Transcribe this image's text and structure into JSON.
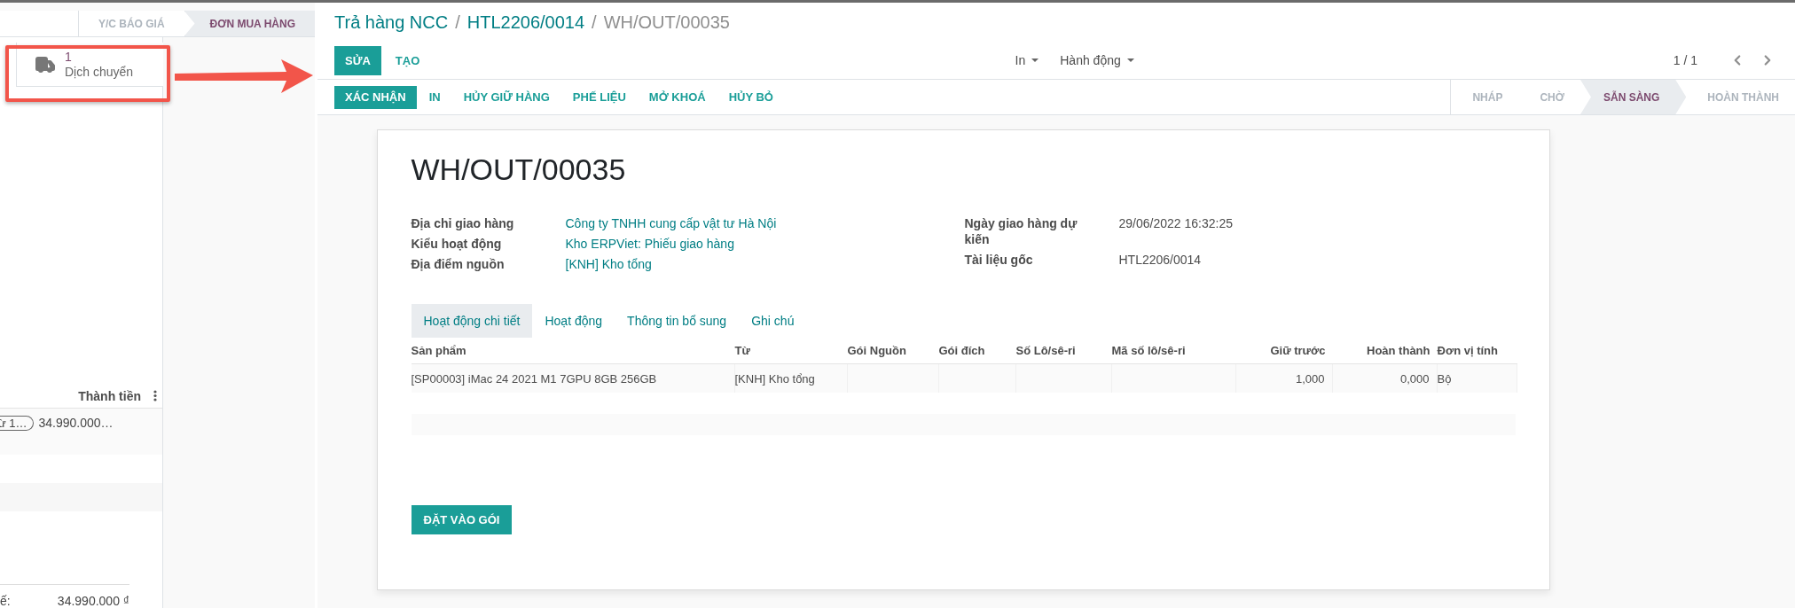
{
  "reference_panel": {
    "stages": [
      {
        "label": "Y/C BÁO GIÁ",
        "selected": false
      },
      {
        "label": "ĐƠN MUA HÀNG",
        "selected": true
      }
    ],
    "smart_button": {
      "count": "1",
      "label": "Dịch chuyển"
    },
    "table": {
      "column": "Thành tiền",
      "rows": [
        {
          "tag": "ừ 1…",
          "amount": "34.990.000…"
        }
      ]
    },
    "totals": [
      {
        "label": "ế:",
        "value": "34.990.000 ₫"
      }
    ]
  },
  "breadcrumb": {
    "separator": "/",
    "items": [
      {
        "label": "Trả hàng NCC",
        "current": false
      },
      {
        "label": "HTL2206/0014",
        "current": false
      },
      {
        "label": "WH/OUT/00035",
        "current": true
      }
    ]
  },
  "buttons": [
    {
      "label": "SỬA",
      "kind": "primary"
    },
    {
      "label": "TẠO",
      "kind": "link"
    }
  ],
  "dropdowns": [
    "In",
    "Hành động"
  ],
  "pager": "1 / 1",
  "actions": [
    {
      "label": "XÁC NHẬN",
      "kind": "primary"
    },
    {
      "label": "IN",
      "kind": "link"
    },
    {
      "label": "HỦY GIỮ HÀNG",
      "kind": "link"
    },
    {
      "label": "PHẾ LIỆU",
      "kind": "link"
    },
    {
      "label": "MỞ KHOÁ",
      "kind": "link"
    },
    {
      "label": "HỦY BỎ",
      "kind": "link"
    }
  ],
  "stages": [
    {
      "label": "NHÁP",
      "selected": false
    },
    {
      "label": "CHỜ",
      "selected": false
    },
    {
      "label": "SẴN SÀNG",
      "selected": true
    },
    {
      "label": "HOÀN THÀNH",
      "selected": false
    }
  ],
  "record": {
    "title": "WH/OUT/00035",
    "fields_left": [
      {
        "label": "Địa chỉ giao hàng",
        "value": "Công ty TNHH cung cấp vật tư Hà Nội"
      },
      {
        "label": "Kiểu hoạt động",
        "value": "Kho ERPViet: Phiếu giao hàng"
      },
      {
        "label": "Địa điểm nguồn",
        "value": "[KNH] Kho tổng"
      }
    ],
    "fields_right": [
      {
        "label": "Ngày giao hàng dự kiến",
        "value": "29/06/2022 16:32:25"
      },
      {
        "label": "Tài liệu gốc",
        "value": "HTL2206/0014"
      }
    ]
  },
  "tabs": [
    {
      "label": "Hoạt động chi tiết",
      "selected": true
    },
    {
      "label": "Hoạt động",
      "selected": false
    },
    {
      "label": "Thông tin bổ sung",
      "selected": false
    },
    {
      "label": "Ghi chú",
      "selected": false
    }
  ],
  "table": {
    "columns": [
      {
        "label": "Sản phẩm",
        "kind": "text"
      },
      {
        "label": "Từ",
        "kind": "text"
      },
      {
        "label": "Gói Nguồn",
        "kind": "text"
      },
      {
        "label": "Gói đích",
        "kind": "text"
      },
      {
        "label": "Số Lô/sê-ri",
        "kind": "text"
      },
      {
        "label": "Mã số lô/sê-ri",
        "kind": "text"
      },
      {
        "label": "Giữ trước",
        "kind": "number"
      },
      {
        "label": "Hoàn thành",
        "kind": "number"
      },
      {
        "label": "Đơn vị tính",
        "kind": "text"
      }
    ],
    "rows": [
      {
        "cells": [
          "[SP00003] iMac 24 2021 M1 7GPU 8GB 256GB",
          "[KNH] Kho tổng",
          "",
          "",
          "",
          "",
          "1,000",
          "0,000",
          "Bộ"
        ]
      }
    ]
  },
  "footer_button": "ĐẶT VÀO GÓI"
}
